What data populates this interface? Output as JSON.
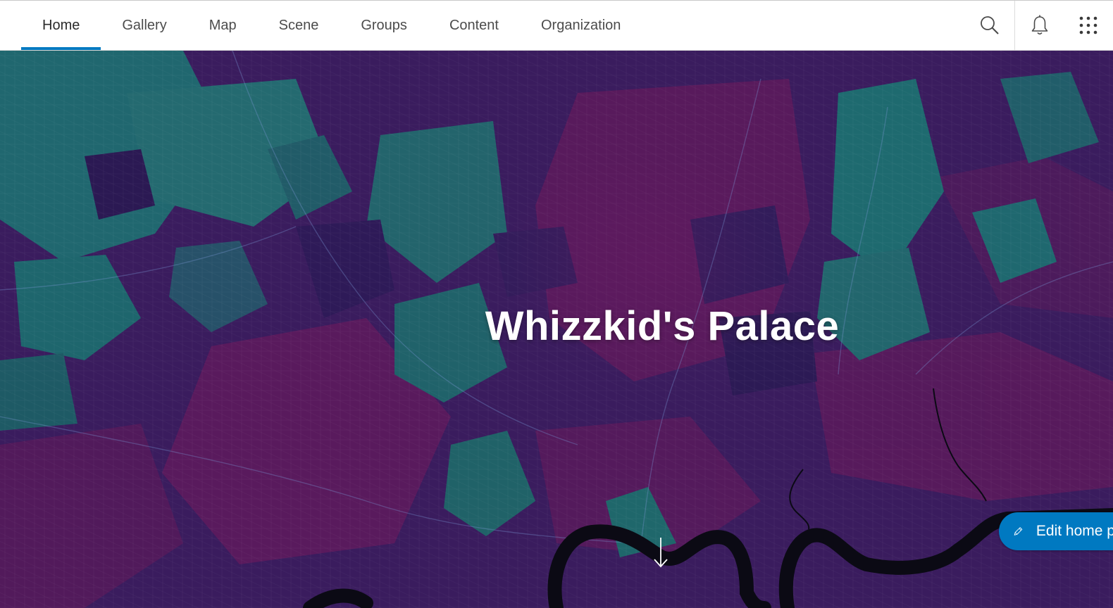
{
  "nav": {
    "items": [
      {
        "label": "Home",
        "active": true
      },
      {
        "label": "Gallery",
        "active": false
      },
      {
        "label": "Map",
        "active": false
      },
      {
        "label": "Scene",
        "active": false
      },
      {
        "label": "Groups",
        "active": false
      },
      {
        "label": "Content",
        "active": false
      },
      {
        "label": "Organization",
        "active": false
      }
    ]
  },
  "tools": {
    "icons": [
      "search-icon",
      "bell-icon",
      "app-launcher-icon"
    ]
  },
  "hero": {
    "title": "Whizzkid's Palace",
    "edit_label": "Edit home page",
    "scroll_icon": "arrow-down-icon"
  },
  "colors": {
    "accent": "#0079c1",
    "map_purple": "#3a1b5c",
    "map_magenta": "#5e1a5e",
    "map_teal": "#1f6f73",
    "river": "#0a0a12"
  }
}
